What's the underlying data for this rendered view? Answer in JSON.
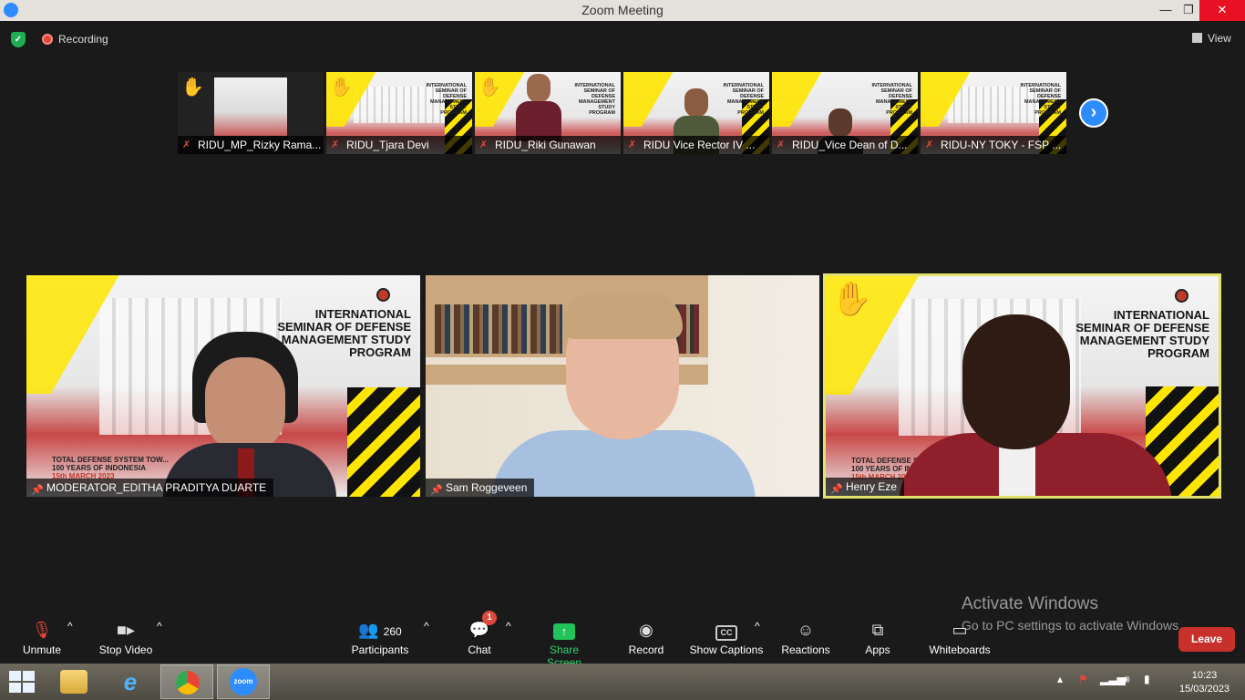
{
  "window": {
    "title": "Zoom Meeting",
    "min": "—",
    "max": "❐",
    "close": "✕"
  },
  "status": {
    "recording_label": "Recording",
    "view_label": "View"
  },
  "seminar": {
    "line1": "INTERNATIONAL",
    "line2": "SEMINAR OF DEFENSE",
    "line3": "MANAGEMENT STUDY",
    "line4": "PROGRAM"
  },
  "thumbnails": [
    {
      "name": "RIDU_MP_Rizky Rama...",
      "hand": "✋",
      "type": "dark"
    },
    {
      "name": "RIDU_Tjara Devi",
      "hand": "✋",
      "type": "banner"
    },
    {
      "name": "RIDU_Riki Gunawan",
      "hand": "✋",
      "type": "person"
    },
    {
      "name": "RIDU Vice Rector IV ...",
      "hand": "",
      "type": "person"
    },
    {
      "name": "RIDU_Vice Dean of D...",
      "hand": "",
      "type": "person"
    },
    {
      "name": "RIDU-NY TOKY - FSP ...",
      "hand": "",
      "type": "banner"
    }
  ],
  "tiles": [
    {
      "name": "MODERATOR_EDITHA PRADITYA DUARTE",
      "sub1": "TOTAL DEFENSE SYSTEM TOW...",
      "sub2": "100 YEARS OF INDONESIA",
      "date": "15th MARCH 2023"
    },
    {
      "name": "Sam Roggeveen"
    },
    {
      "name": "Henry Eze",
      "hand": "✋",
      "sub1": "TOTAL DEFENSE SYSTE...",
      "sub2": "100 YEARS OF INDONE...",
      "date": "15th MARCH 2023"
    }
  ],
  "watermark": {
    "line1": "Activate Windows",
    "line2": "Go to PC settings to activate Windows."
  },
  "toolbar": {
    "unmute": "Unmute",
    "stop_video": "Stop Video",
    "participants": "Participants",
    "participants_count": "260",
    "chat": "Chat",
    "chat_badge": "1",
    "share_screen": "Share Screen",
    "record": "Record",
    "show_captions": "Show Captions",
    "cc": "CC",
    "reactions": "Reactions",
    "apps": "Apps",
    "whiteboards": "Whiteboards",
    "leave": "Leave"
  },
  "taskbar": {
    "time": "10:23",
    "date": "15/03/2023",
    "zoom_label": "zoom"
  },
  "colors": {
    "accent": "#2d8cff",
    "share_green": "#22c35a",
    "leave_red": "#c8312b",
    "highlight": "#e2e36f"
  }
}
